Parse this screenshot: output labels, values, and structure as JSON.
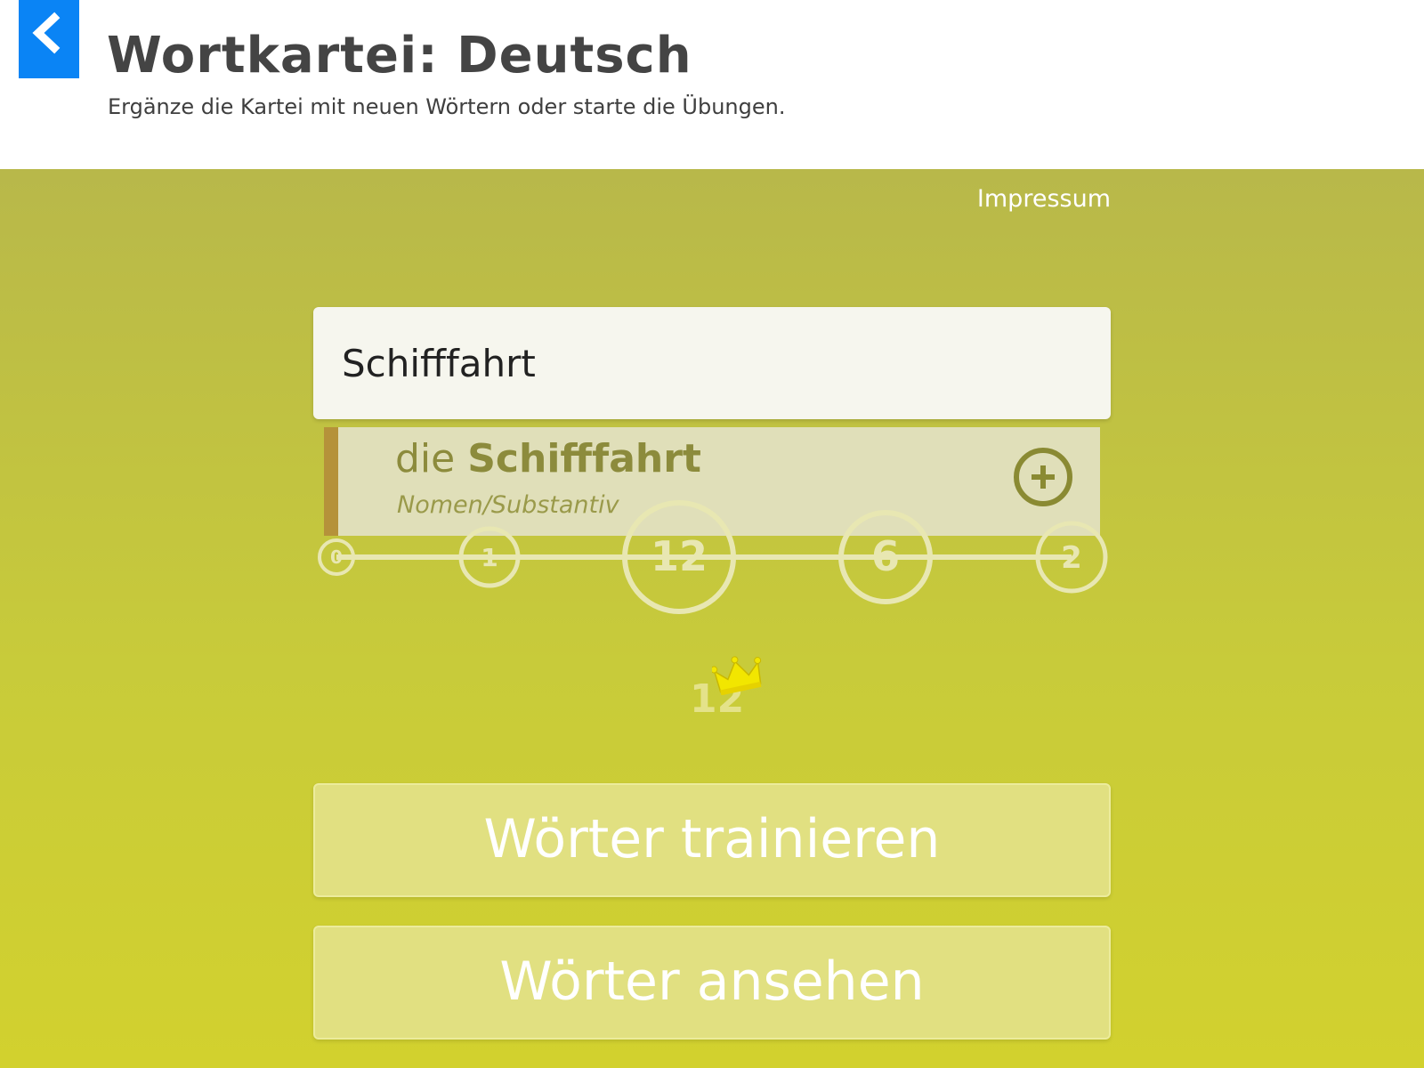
{
  "header": {
    "back_icon": "chevron-left-icon",
    "title": "Wortkartei: Deutsch",
    "subtitle": "Ergänze die Kartei mit neuen Wörtern oder starte die Übungen."
  },
  "impressum_label": "Impressum",
  "search": {
    "value": "Schifffahrt"
  },
  "suggestion": {
    "article": "die",
    "word": "Schifffahrt",
    "type": "Nomen/Substantiv",
    "add_icon": "plus-circle-icon"
  },
  "progress": {
    "levels": [
      "0",
      "1",
      "12",
      "6",
      "2"
    ]
  },
  "score": {
    "value": "12",
    "icon": "crown-icon"
  },
  "buttons": {
    "train_label": "Wörter trainieren",
    "view_label": "Wörter ansehen"
  },
  "colors": {
    "accent_blue": "#0a84f5",
    "background_top": "#b8b84a",
    "background_bottom": "#d2d12e",
    "suggestion_bar": "#b5923a",
    "crown": "#f2e600"
  }
}
